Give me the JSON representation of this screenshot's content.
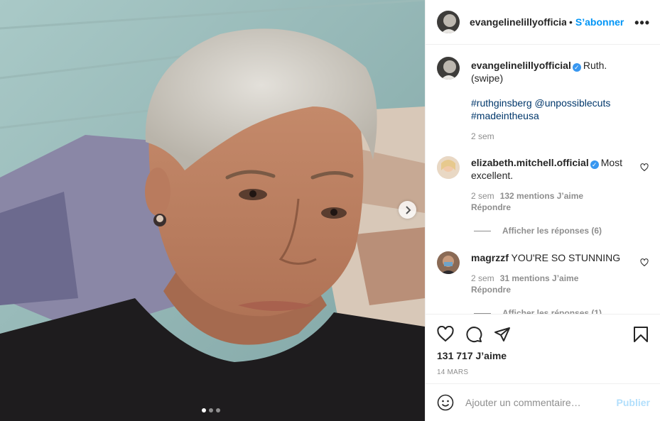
{
  "post": {
    "author": "evangelinelillyofficial",
    "follow_label": "S’abonner",
    "separator": "•",
    "more_label": "•••",
    "photo": {
      "alt": "Selfie of a woman with very short platinum hair lying against a cushion",
      "carousel_dots": 3,
      "active_dot": 0
    }
  },
  "caption": {
    "user": "evangelinelillyofficial",
    "text": "Ruth. (swipe)",
    "hashtags_line1": "#ruthginsberg @unpossiblecuts",
    "hashtags_line2": "#madeintheusa",
    "time": "2 sem"
  },
  "comments": [
    {
      "user": "elizabeth.mitchell.official",
      "verified": true,
      "text": "Most excellent.",
      "time": "2 sem",
      "likes": "132 mentions J’aime",
      "reply": "Répondre",
      "view_replies": "Afficher les réponses (6)"
    },
    {
      "user": "magrzzf",
      "verified": false,
      "text": "YOU'RE SO STUNNING",
      "time": "2 sem",
      "likes": "31 mentions J’aime",
      "reply": "Répondre",
      "view_replies": "Afficher les réponses (1)"
    }
  ],
  "actions": {
    "likes_count": "131 717 J’aime",
    "date": "14 mars"
  },
  "comment_box": {
    "placeholder": "Ajouter un commentaire…",
    "publish_label": "Publier"
  },
  "colors": {
    "link_blue": "#0095f6",
    "tag_blue": "#00376b",
    "muted": "#8e8e8e",
    "verified": "#3897f0"
  },
  "icons": [
    "heart-icon",
    "comment-icon",
    "share-icon",
    "bookmark-icon",
    "emoji-icon",
    "chevron-right-icon",
    "more-icon"
  ]
}
